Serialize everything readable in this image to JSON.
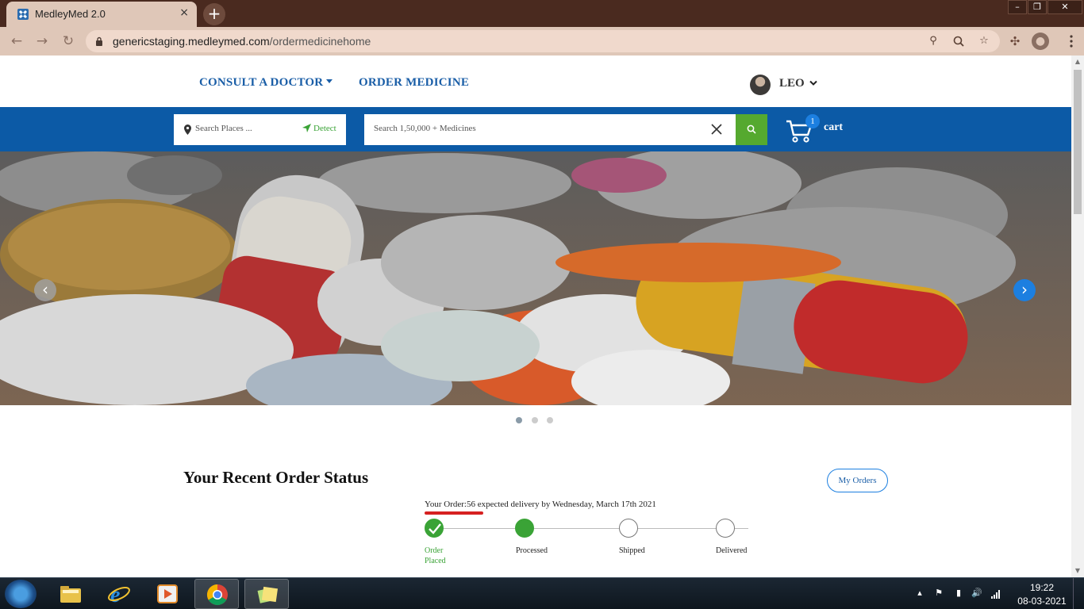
{
  "browser": {
    "tab_title": "MedleyMed 2.0",
    "tab_close": "×",
    "new_tab": "+",
    "url_host": "genericstaging.medleymed.com",
    "url_path": "/ordermedicinehome",
    "window_controls": [
      "–",
      "❐",
      "✕"
    ]
  },
  "nav": {
    "consult": "CONSULT A DOCTOR",
    "order": "ORDER MEDICINE",
    "user": "LEO"
  },
  "search": {
    "place_placeholder": "Search Places ...",
    "detect_label": "Detect",
    "medicine_placeholder": "Search  1,50,000 + Medicines"
  },
  "cart": {
    "count": "1",
    "label": "cart"
  },
  "carousel": {
    "prev": "‹",
    "next": "›",
    "slides": 3,
    "active_slide": 1
  },
  "order_status": {
    "title": "Your Recent Order Status",
    "my_orders": "My Orders",
    "line": "Your Order:56 expected delivery by Wednesday, March 17th 2021",
    "steps": [
      {
        "label": "Order Placed",
        "done": true,
        "checked": true
      },
      {
        "label": "Processed",
        "done": true,
        "checked": false
      },
      {
        "label": "Shipped",
        "done": false,
        "checked": false
      },
      {
        "label": "Delivered",
        "done": false,
        "checked": false
      }
    ]
  },
  "taskbar": {
    "time": "19:22",
    "date": "08-03-2021"
  },
  "colors": {
    "brand_blue": "#0c5aa6",
    "link_blue": "#1a5ea7",
    "green": "#3aa336",
    "red": "#d62020"
  }
}
